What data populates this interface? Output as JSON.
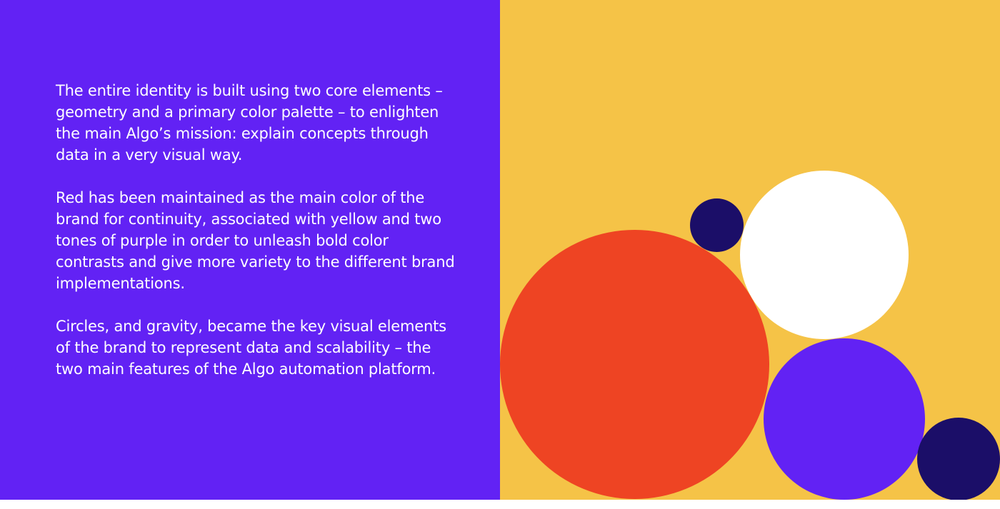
{
  "colors": {
    "purple": "#6222F4",
    "yellow": "#F5C347",
    "red": "#EE4423",
    "white": "#FFFFFF",
    "navy": "#1B0E68"
  },
  "text": {
    "paragraph_1": "The entire identity is built using two core elements – geometry and a primary color palette – to enlighten the main Algo’s mission: explain concepts through data in a very visual way.",
    "paragraph_2": "Red has been maintained as the main color of the brand for continuity, associated with yellow and two tones of purple in order to unleash bold color contrasts and give more variety to the different brand implementations.",
    "paragraph_3": "Circles, and gravity, became the key visual elements of the brand to represent data and scalability – the two main features of the Algo automation platform."
  }
}
